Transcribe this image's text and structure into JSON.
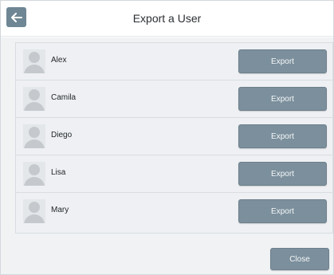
{
  "header": {
    "title": "Export a User",
    "back_icon": "arrow-left-icon"
  },
  "users": [
    {
      "name": "Alex",
      "export_label": "Export"
    },
    {
      "name": "Camila",
      "export_label": "Export"
    },
    {
      "name": "Diego",
      "export_label": "Export"
    },
    {
      "name": "Lisa",
      "export_label": "Export"
    },
    {
      "name": "Mary",
      "export_label": "Export"
    }
  ],
  "footer": {
    "close_label": "Close"
  },
  "colors": {
    "button": "#7b8f9c",
    "back_button": "#6f8794",
    "body_background": "#f0f2f4"
  }
}
